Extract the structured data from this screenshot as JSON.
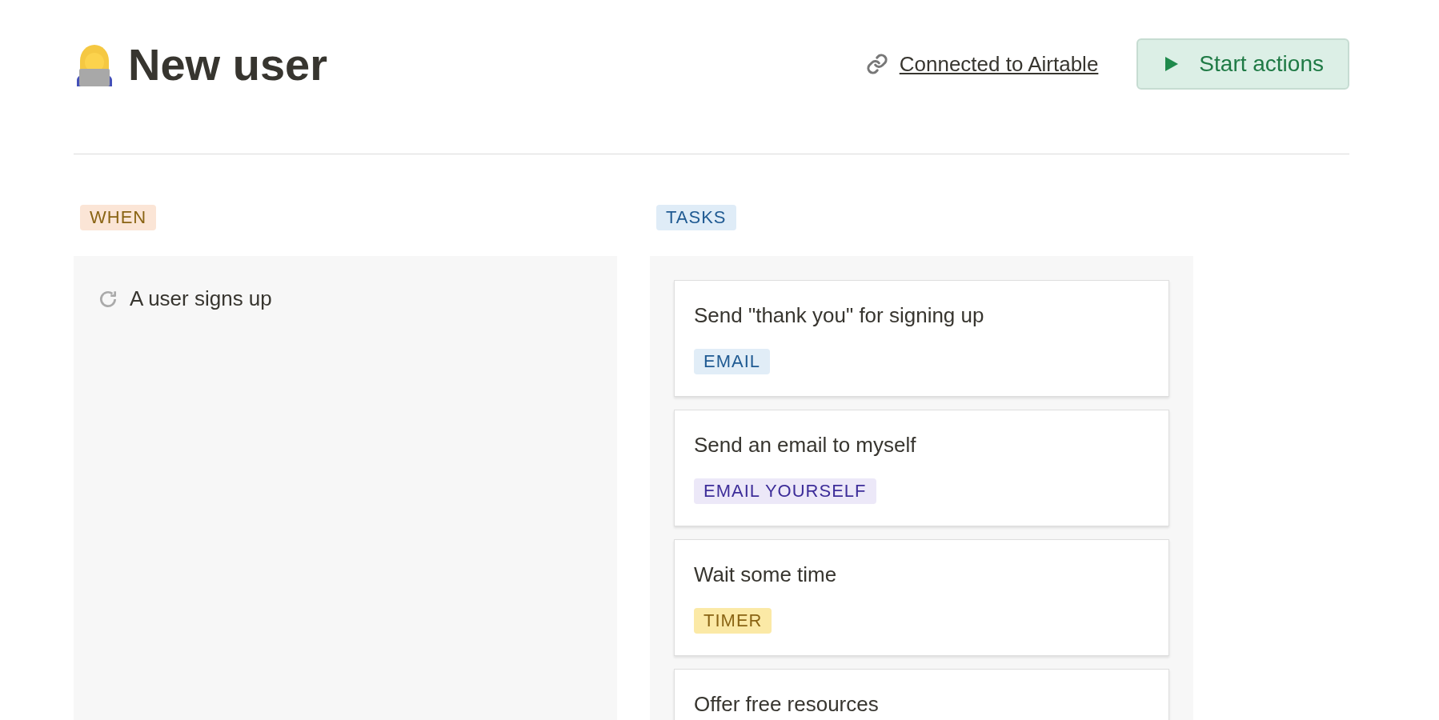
{
  "header": {
    "title": "New user",
    "link": "Connected to Airtable",
    "button": "Start actions"
  },
  "when": {
    "label": "WHEN",
    "trigger": "A user signs up"
  },
  "tasks": {
    "label": "TASKS",
    "items": [
      {
        "title": "Send \"thank you\" for signing up",
        "tag": "EMAIL",
        "kind": "email",
        "color": "#e1edf7"
      },
      {
        "title": "Send an email to myself",
        "tag": "EMAIL YOURSELF",
        "kind": "email_yourself",
        "color": "#ece8f8"
      },
      {
        "title": "Wait some time",
        "tag": "TIMER",
        "kind": "timer",
        "color": "#fbe9a6"
      },
      {
        "title": "Offer free resources"
      }
    ]
  }
}
